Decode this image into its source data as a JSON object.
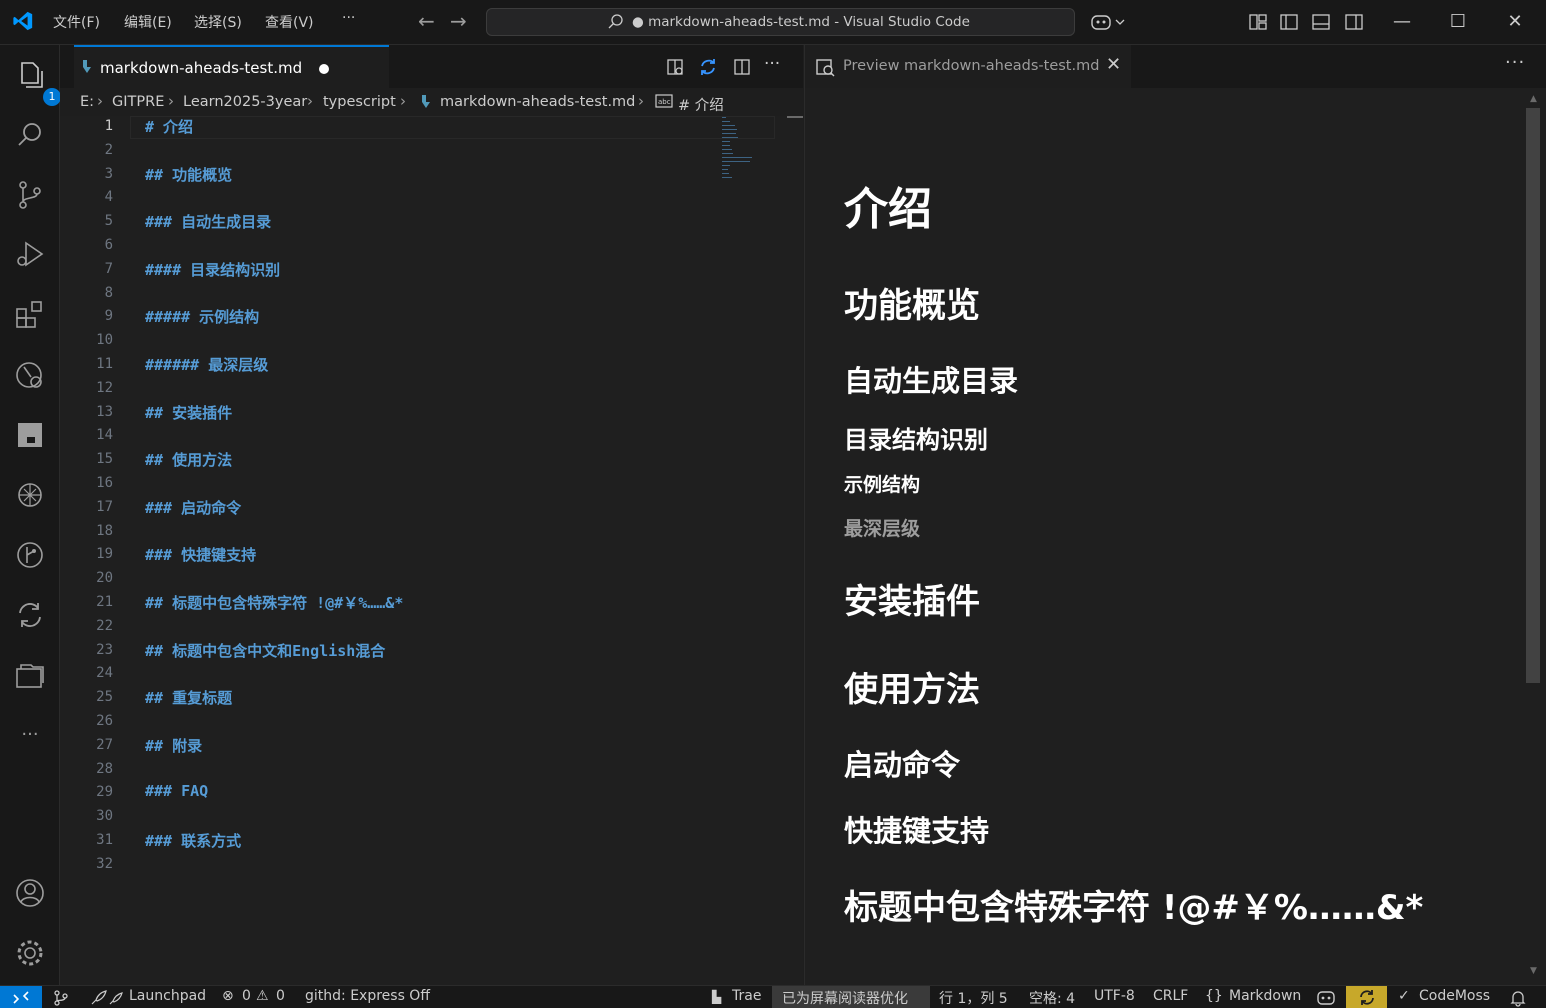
{
  "titlebar": {
    "menus": [
      "文件(F)",
      "编辑(E)",
      "选择(S)",
      "查看(V)"
    ],
    "more": "···",
    "command_center": "● markdown-aheads-test.md - Visual Studio Code"
  },
  "activity": {
    "explorer_badge": "1"
  },
  "editor": {
    "tab_label": "markdown-aheads-test.md",
    "breadcrumb": [
      "E:",
      "GITPRE",
      "Learn2025-3year",
      "typescript",
      "markdown-aheads-test.md",
      "# 介绍"
    ],
    "actions_more": "···",
    "lines": [
      {
        "n": "1",
        "t": "# 介绍"
      },
      {
        "n": "2",
        "t": ""
      },
      {
        "n": "3",
        "t": "## 功能概览"
      },
      {
        "n": "4",
        "t": ""
      },
      {
        "n": "5",
        "t": "### 自动生成目录"
      },
      {
        "n": "6",
        "t": ""
      },
      {
        "n": "7",
        "t": "#### 目录结构识别"
      },
      {
        "n": "8",
        "t": ""
      },
      {
        "n": "9",
        "t": "##### 示例结构"
      },
      {
        "n": "10",
        "t": ""
      },
      {
        "n": "11",
        "t": "###### 最深层级"
      },
      {
        "n": "12",
        "t": ""
      },
      {
        "n": "13",
        "t": "## 安装插件"
      },
      {
        "n": "14",
        "t": ""
      },
      {
        "n": "15",
        "t": "## 使用方法"
      },
      {
        "n": "16",
        "t": ""
      },
      {
        "n": "17",
        "t": "### 启动命令"
      },
      {
        "n": "18",
        "t": ""
      },
      {
        "n": "19",
        "t": "### 快捷键支持"
      },
      {
        "n": "20",
        "t": ""
      },
      {
        "n": "21",
        "t": "## 标题中包含特殊字符 !@#￥%……&*"
      },
      {
        "n": "22",
        "t": ""
      },
      {
        "n": "23",
        "t": "## 标题中包含中文和English混合"
      },
      {
        "n": "24",
        "t": ""
      },
      {
        "n": "25",
        "t": "## 重复标题"
      },
      {
        "n": "26",
        "t": ""
      },
      {
        "n": "27",
        "t": "## 附录"
      },
      {
        "n": "28",
        "t": ""
      },
      {
        "n": "29",
        "t": "### FAQ"
      },
      {
        "n": "30",
        "t": ""
      },
      {
        "n": "31",
        "t": "### 联系方式"
      },
      {
        "n": "32",
        "t": ""
      }
    ]
  },
  "preview": {
    "tab_label": "Preview markdown-aheads-test.md",
    "more": "···",
    "headings": [
      {
        "level": 1,
        "text": "介绍"
      },
      {
        "level": 2,
        "text": "功能概览"
      },
      {
        "level": 3,
        "text": "自动生成目录"
      },
      {
        "level": 4,
        "text": "目录结构识别"
      },
      {
        "level": 5,
        "text": "示例结构"
      },
      {
        "level": 6,
        "text": "最深层级"
      },
      {
        "level": 2,
        "text": "安装插件"
      },
      {
        "level": 2,
        "text": "使用方法"
      },
      {
        "level": 3,
        "text": "启动命令"
      },
      {
        "level": 3,
        "text": "快捷键支持"
      },
      {
        "level": 2,
        "text": "标题中包含特殊字符 !@#￥%……&*"
      }
    ]
  },
  "statusbar": {
    "launchpad": "Launchpad",
    "errors": "0",
    "warnings": "0",
    "githd": "githd: Express Off",
    "trae": "Trae",
    "screen_reader": "已为屏幕阅读器优化",
    "position": "行 1，列 5",
    "spaces": "空格: 4",
    "encoding": "UTF-8",
    "eol": "CRLF",
    "language": "Markdown",
    "codemoss": "CodeMoss"
  },
  "colors": {
    "accent": "#0078d4",
    "heading_code": "#569cd6",
    "background": "#1f1f1f"
  }
}
